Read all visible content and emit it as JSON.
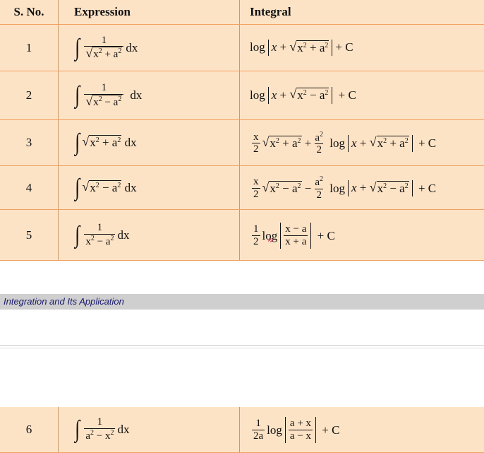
{
  "headers": {
    "sno": "S. No.",
    "expression": "Expression",
    "integral": "Integral"
  },
  "rows": [
    {
      "sno": "1"
    },
    {
      "sno": "2"
    },
    {
      "sno": "3"
    },
    {
      "sno": "4"
    },
    {
      "sno": "5"
    },
    {
      "sno": "6"
    }
  ],
  "section_title": "Integration and Its Application",
  "colors": {
    "cell_bg": "#fde3c6",
    "row_border": "#f0a060",
    "bar_bg": "#cfcfcf",
    "title_color": "#1a1a6e"
  }
}
